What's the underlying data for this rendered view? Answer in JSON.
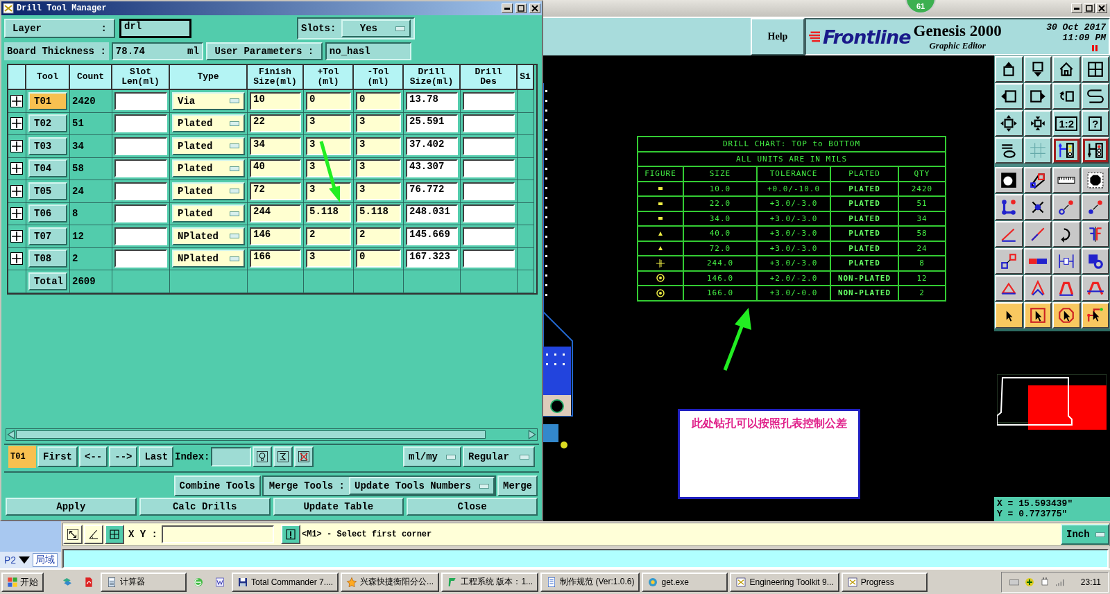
{
  "dialog": {
    "title": "Drill Tool Manager",
    "layer": {
      "label": "Layer",
      "separator": ":",
      "value": "drl"
    },
    "slots": {
      "label": "Slots:",
      "value": "Yes"
    },
    "board_thickness": {
      "label": "Board Thickness :",
      "value": "78.74",
      "unit": "ml"
    },
    "user_parameters": {
      "label": "User Parameters :",
      "value": "no_hasl"
    },
    "table": {
      "columns": [
        "Tool",
        "Count",
        "Slot\nLen(ml)",
        "Type",
        "Finish\nSize(ml)",
        "+Tol\n(ml)",
        "-Tol\n(ml)",
        "Drill\nSize(ml)",
        "Drill\nDes",
        "Si"
      ],
      "rows": [
        {
          "tool": "T01",
          "count": "2420",
          "type": "Via",
          "finish": "10",
          "plus_tol": "0",
          "minus_tol": "0",
          "drill_size": "13.78",
          "selected": true
        },
        {
          "tool": "T02",
          "count": "51",
          "type": "Plated",
          "finish": "22",
          "plus_tol": "3",
          "minus_tol": "3",
          "drill_size": "25.591",
          "selected": false
        },
        {
          "tool": "T03",
          "count": "34",
          "type": "Plated",
          "finish": "34",
          "plus_tol": "3",
          "minus_tol": "3",
          "drill_size": "37.402",
          "selected": false
        },
        {
          "tool": "T04",
          "count": "58",
          "type": "Plated",
          "finish": "40",
          "plus_tol": "3",
          "minus_tol": "3",
          "drill_size": "43.307",
          "selected": false
        },
        {
          "tool": "T05",
          "count": "24",
          "type": "Plated",
          "finish": "72",
          "plus_tol": "3",
          "minus_tol": "3",
          "drill_size": "76.772",
          "selected": false
        },
        {
          "tool": "T06",
          "count": "8",
          "type": "Plated",
          "finish": "244",
          "plus_tol": "5.118",
          "minus_tol": "5.118",
          "drill_size": "248.031",
          "selected": false
        },
        {
          "tool": "T07",
          "count": "12",
          "type": "NPlated",
          "finish": "146",
          "plus_tol": "2",
          "minus_tol": "2",
          "drill_size": "145.669",
          "selected": false
        },
        {
          "tool": "T08",
          "count": "2",
          "type": "NPlated",
          "finish": "166",
          "plus_tol": "3",
          "minus_tol": "0",
          "drill_size": "167.323",
          "selected": false
        }
      ],
      "total": {
        "label": "Total",
        "count": "2609"
      }
    },
    "navigation": {
      "current_tool": "T01",
      "buttons": [
        "First",
        "<--",
        "-->",
        "Last"
      ],
      "index_label": "Index:",
      "units": "ml/my",
      "mode": "Regular"
    },
    "merge": {
      "combine": "Combine Tools",
      "label": "Merge Tools :",
      "option": "Update Tools Numbers",
      "button": "Merge"
    },
    "actions": [
      "Apply",
      "Calc Drills",
      "Update Table",
      "Close"
    ]
  },
  "editor": {
    "badge": "61",
    "help": "Help",
    "logo": "Frontline",
    "product": "Genesis 2000",
    "subtitle": "Graphic Editor",
    "date": "30 Oct 2017",
    "time": "11:09 PM",
    "drill_chart": {
      "title": "DRILL CHART: TOP to BOTTOM",
      "subtitle": "ALL UNITS ARE IN MILS",
      "columns": [
        "FIGURE",
        "SIZE",
        "TOLERANCE",
        "PLATED",
        "QTY"
      ],
      "rows": [
        {
          "kind": "square",
          "size": "10.0",
          "tolerance": "+0.0/-10.0",
          "plated": "PLATED",
          "qty": "2420"
        },
        {
          "kind": "square",
          "size": "22.0",
          "tolerance": "+3.0/-3.0",
          "plated": "PLATED",
          "qty": "51"
        },
        {
          "kind": "square",
          "size": "34.0",
          "tolerance": "+3.0/-3.0",
          "plated": "PLATED",
          "qty": "34"
        },
        {
          "kind": "triangle",
          "size": "40.0",
          "tolerance": "+3.0/-3.0",
          "plated": "PLATED",
          "qty": "58"
        },
        {
          "kind": "triangle",
          "size": "72.0",
          "tolerance": "+3.0/-3.0",
          "plated": "PLATED",
          "qty": "24"
        },
        {
          "kind": "cross",
          "size": "244.0",
          "tolerance": "+3.0/-3.0",
          "plated": "PLATED",
          "qty": "8"
        },
        {
          "kind": "circle",
          "size": "146.0",
          "tolerance": "+2.0/-2.0",
          "plated": "NON-PLATED",
          "qty": "12"
        },
        {
          "kind": "circle",
          "size": "166.0",
          "tolerance": "+3.0/-0.0",
          "plated": "NON-PLATED",
          "qty": "2"
        }
      ]
    },
    "note": "此处钻孔可以按照孔表控制公差",
    "toolbar": [
      {
        "kind": "view",
        "on": false
      },
      {
        "kind": "view",
        "on": false
      },
      {
        "kind": "view",
        "on": false
      },
      {
        "kind": "view",
        "on": false
      },
      {
        "kind": "view",
        "on": false
      },
      {
        "kind": "view",
        "on": false
      },
      {
        "kind": "view",
        "on": false
      },
      {
        "kind": "view",
        "on": false
      },
      {
        "kind": "view",
        "on": false
      },
      {
        "kind": "view",
        "on": false
      },
      {
        "kind": "view",
        "on": false,
        "label": "1:2"
      },
      {
        "kind": "view",
        "on": false,
        "label": "?"
      },
      {
        "kind": "view",
        "on": false
      },
      {
        "kind": "view",
        "on": false
      },
      {
        "kind": "view",
        "on": true
      },
      {
        "kind": "view",
        "on": true
      },
      {
        "kind": "edit",
        "on": false
      },
      {
        "kind": "edit",
        "on": false
      },
      {
        "kind": "edit",
        "on": false
      },
      {
        "kind": "edit",
        "on": false
      },
      {
        "kind": "edit",
        "on": false
      },
      {
        "kind": "edit",
        "on": false
      },
      {
        "kind": "edit",
        "on": false
      },
      {
        "kind": "edit",
        "on": false
      },
      {
        "kind": "edit",
        "on": false
      },
      {
        "kind": "edit",
        "on": false
      },
      {
        "kind": "edit",
        "on": false
      },
      {
        "kind": "edit",
        "on": false
      },
      {
        "kind": "edit",
        "on": false
      },
      {
        "kind": "edit",
        "on": false
      },
      {
        "kind": "edit",
        "on": false
      },
      {
        "kind": "edit",
        "on": false
      },
      {
        "kind": "edit",
        "on": false
      },
      {
        "kind": "edit",
        "on": false
      },
      {
        "kind": "edit",
        "on": false
      },
      {
        "kind": "edit",
        "on": false
      },
      {
        "kind": "select",
        "on": false
      },
      {
        "kind": "select",
        "on": false
      },
      {
        "kind": "select",
        "on": false
      },
      {
        "kind": "select",
        "on": false
      }
    ],
    "coordinates": {
      "x": "X = 15.593439\"",
      "y": "Y = 0.773775\""
    },
    "command": {
      "xy_label": "X Y :",
      "message": "<M1> - Select first corner",
      "units": "Inch"
    }
  },
  "side_panel": {
    "page": "P2",
    "tab": "局域"
  },
  "taskbar": {
    "start": "开始",
    "items": [
      {
        "kind": "launcher"
      },
      {
        "kind": "launcher"
      },
      {
        "kind": "task",
        "label": "计算器"
      },
      {
        "kind": "launcher"
      },
      {
        "kind": "launcher"
      },
      {
        "kind": "task",
        "label": "Total Commander 7...."
      },
      {
        "kind": "task",
        "label": "兴森快捷衡阳分公..."
      },
      {
        "kind": "task",
        "label": "工程系统  版本：1..."
      },
      {
        "kind": "task",
        "label": "制作规范 (Ver:1.0.6)"
      },
      {
        "kind": "task",
        "label": "get.exe"
      },
      {
        "kind": "task",
        "label": "Engineering Toolkit 9..."
      },
      {
        "kind": "task",
        "label": "Progress"
      }
    ],
    "clock": "23:11"
  }
}
